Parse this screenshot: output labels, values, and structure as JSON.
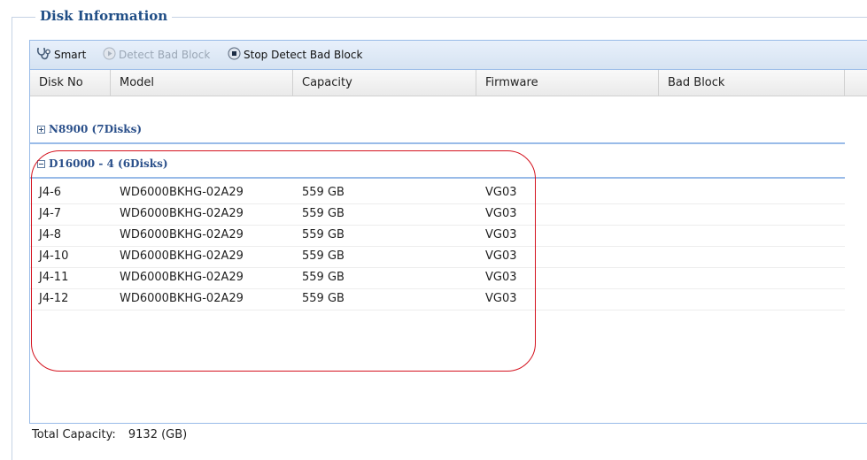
{
  "fieldset": {
    "legend": "Disk Information"
  },
  "toolbar": {
    "smart_label": "Smart",
    "detect_label": "Detect Bad Block",
    "stop_label": "Stop Detect Bad Block"
  },
  "columns": [
    "Disk No",
    "Model",
    "Capacity",
    "Firmware",
    "Bad Block"
  ],
  "groups": [
    {
      "label": "N8900 (7Disks)",
      "state": "collapsed"
    },
    {
      "label": "D16000 - 4 (6Disks)",
      "state": "expanded"
    }
  ],
  "rows": [
    {
      "disk_no": "J4-6",
      "model": "WD6000BKHG-02A29",
      "capacity": "559 GB",
      "firmware": "VG03",
      "bad_block": ""
    },
    {
      "disk_no": "J4-7",
      "model": "WD6000BKHG-02A29",
      "capacity": "559 GB",
      "firmware": "VG03",
      "bad_block": ""
    },
    {
      "disk_no": "J4-8",
      "model": "WD6000BKHG-02A29",
      "capacity": "559 GB",
      "firmware": "VG03",
      "bad_block": ""
    },
    {
      "disk_no": "J4-10",
      "model": "WD6000BKHG-02A29",
      "capacity": "559 GB",
      "firmware": "VG03",
      "bad_block": ""
    },
    {
      "disk_no": "J4-11",
      "model": "WD6000BKHG-02A29",
      "capacity": "559 GB",
      "firmware": "VG03",
      "bad_block": ""
    },
    {
      "disk_no": "J4-12",
      "model": "WD6000BKHG-02A29",
      "capacity": "559 GB",
      "firmware": "VG03",
      "bad_block": ""
    }
  ],
  "footer": {
    "total_label": "Total Capacity:",
    "total_value": "9132 (GB)"
  },
  "icons": {
    "smart": "stethoscope-icon",
    "detect": "play-circle-icon",
    "stop": "stop-circle-icon",
    "group_collapsed": "plus-box-icon",
    "group_expanded": "minus-box-icon"
  },
  "colors": {
    "legend": "#204e86",
    "group_label": "#2a4f8a",
    "highlight_oval": "#d4121e",
    "panel_border": "#99bbe8"
  }
}
